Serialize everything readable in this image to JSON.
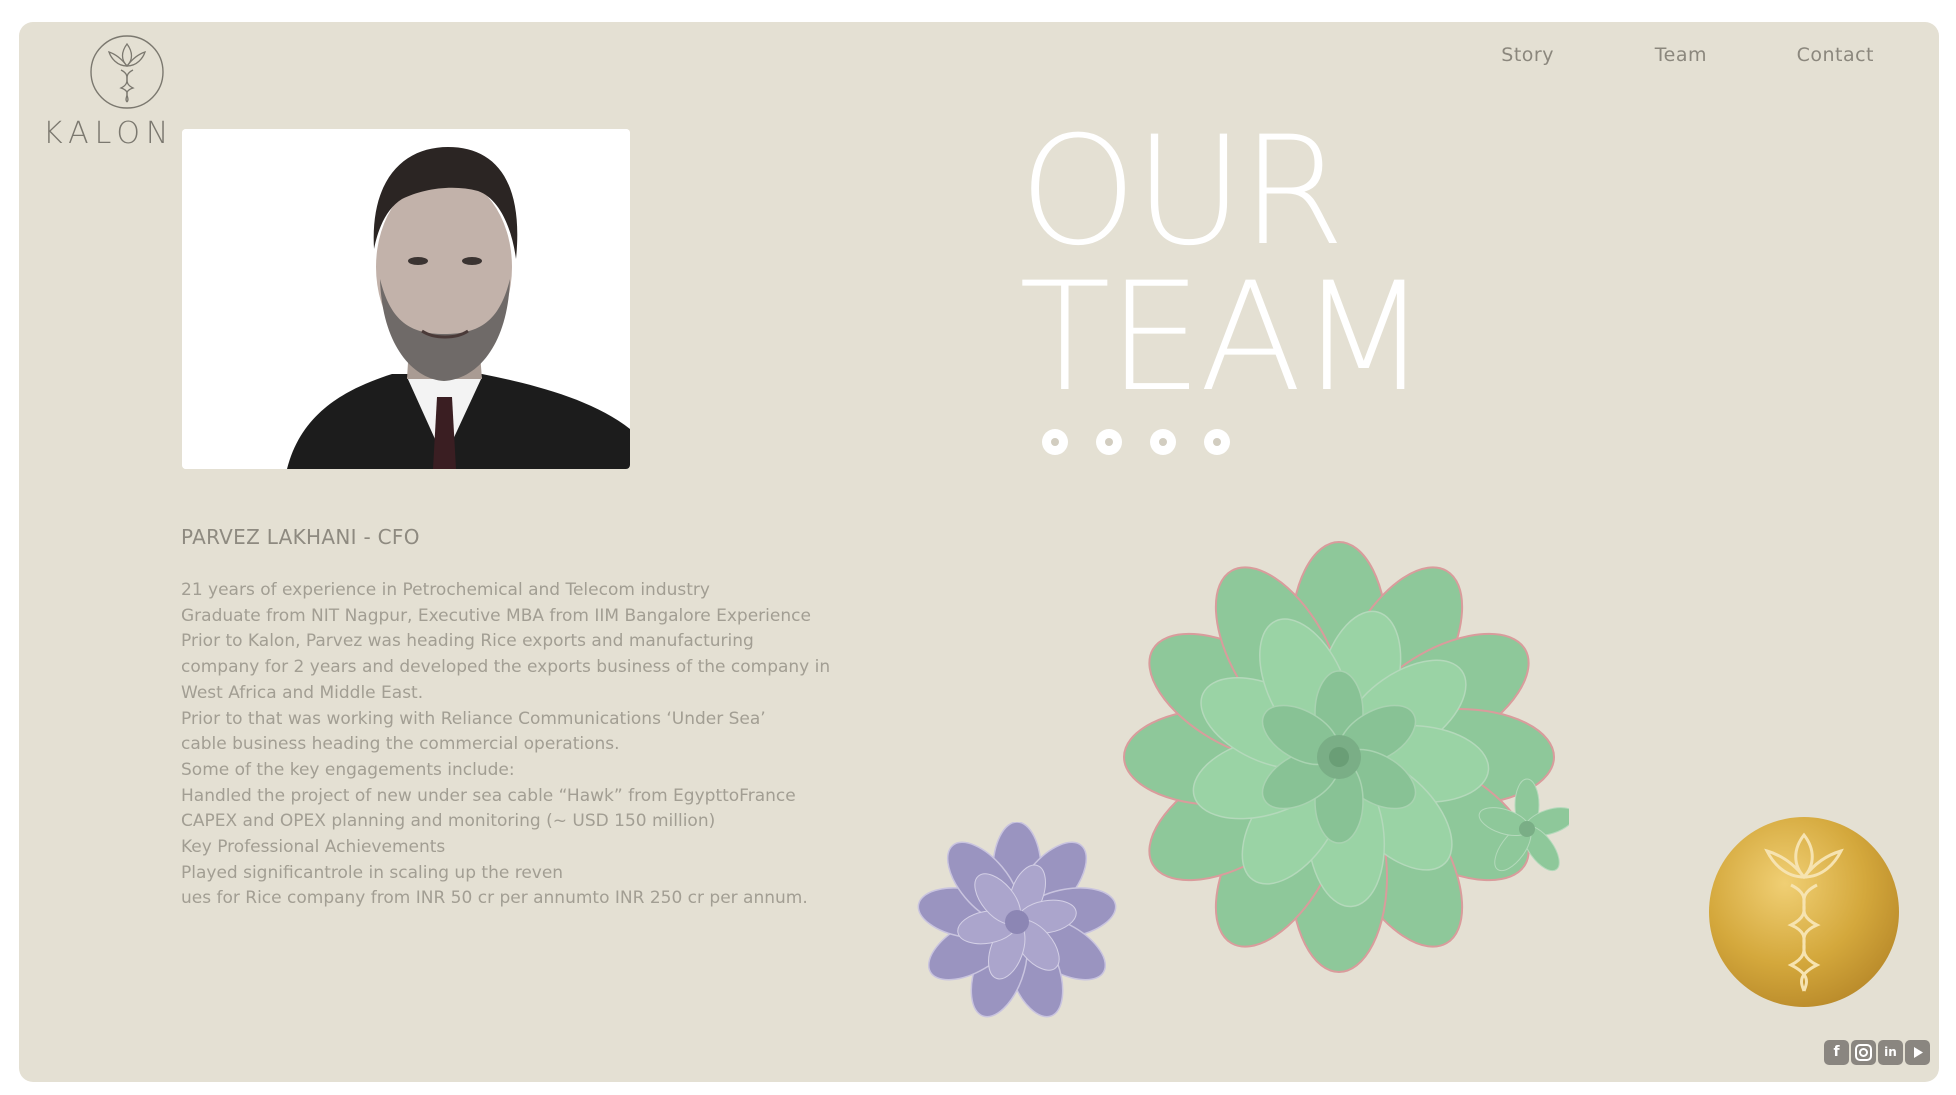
{
  "brand": {
    "name": "KALON"
  },
  "nav": {
    "items": [
      "Story",
      "Team",
      "Contact"
    ]
  },
  "headline": {
    "line1": "OUR",
    "line2": "TEAM"
  },
  "carousel": {
    "dot_count": 4
  },
  "member": {
    "title": "PARVEZ LAKHANI  -  CFO",
    "bio_lines": [
      "21 years of experience in Petrochemical and Telecom industry",
      "Graduate from NIT Nagpur, Executive MBA from IIM Bangalore Experience",
      "Prior to Kalon, Parvez was heading Rice exports and manufacturing",
      "company for 2 years and developed the exports business of the company in",
      "West Africa and Middle East.",
      "Prior to that was working with Reliance Communications   ‘Under Sea’",
      "cable business heading the commercial operations.",
      "Some of the key engagements include:",
      "Handled the project of new under sea cable   “Hawk”   from EgypttoFrance",
      "CAPEX and OPEX planning and monitoring (~ USD 150 million)",
      "Key Professional Achievements",
      "Played significantrole in scaling up the reven",
      "ues for Rice company from INR 50 cr per annumto INR 250 cr per annum."
    ]
  },
  "social": {
    "icons": [
      "facebook-icon",
      "instagram-icon",
      "linkedin-icon",
      "youtube-icon"
    ]
  },
  "colors": {
    "background": "#e4e0d3",
    "headline": "#ffffff",
    "text": "#a29e93",
    "gold": "#d4a83c",
    "succulent_green": "#8ec89a",
    "succulent_purple": "#9a94c0"
  }
}
